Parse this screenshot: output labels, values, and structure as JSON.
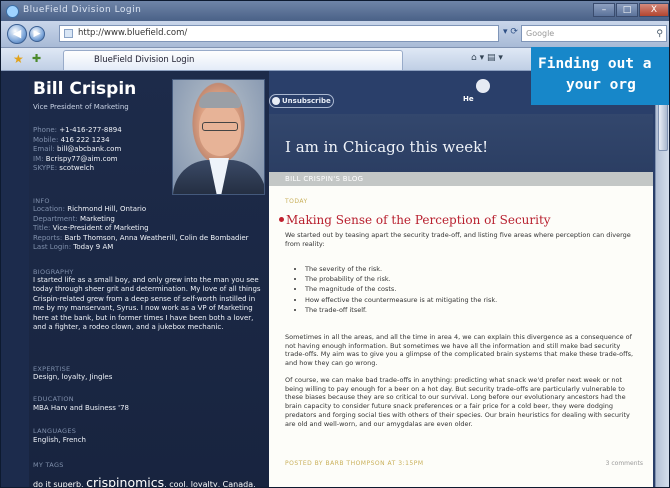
{
  "window": {
    "title": "BlueField Division Login",
    "controls": {
      "minimize": "–",
      "maximize": "□",
      "close": "X"
    }
  },
  "navbar": {
    "back": "◀",
    "forward": "▶",
    "url": "http://www.bluefield.com/",
    "search_placeholder": "Google"
  },
  "tabs": [
    {
      "label": "BlueField Division Login"
    }
  ],
  "profile": {
    "name": "Bill Crispin",
    "role": "Vice President of Marketing",
    "contact": [
      {
        "k": "Phone:",
        "v": "+1-416-277-8894"
      },
      {
        "k": "Mobile:",
        "v": "416 222 1234"
      },
      {
        "k": "Email:",
        "v": "bill@abcbank.com"
      },
      {
        "k": "IM:",
        "v": "Bcrispy77@aim.com"
      },
      {
        "k": "SKYPE:",
        "v": "scotwelch"
      }
    ],
    "info_heading": "INFO",
    "info": [
      {
        "k": "Location:",
        "v": "Richmond Hill, Ontario"
      },
      {
        "k": "Department:",
        "v": "Marketing"
      },
      {
        "k": "Title:",
        "v": "Vice-President of Marketing"
      },
      {
        "k": "Reports:",
        "v": "Barb Thomson, Anna Weatherill, Colin de Bombadier"
      },
      {
        "k": "Last Login:",
        "v": "Today 9 AM"
      }
    ],
    "biography_heading": "BIOGRAPHY",
    "biography": "I started life as a small boy, and only grew into the man you see today through sheer grit and determination. My love of all things Crispin-related grew from a deep sense of self-worth instilled in me by my manservant, Syrus. I now work as a VP of Marketing here at the bank, but in former times I have been both a lover, and a fighter, a rodeo clown, and a jukebox mechanic.",
    "expertise_heading": "EXPERTISE",
    "expertise": "Design, loyalty, Jingles",
    "education_heading": "EDUCATION",
    "education": "MBA Harv and Business '78",
    "languages_heading": "LANGUAGES",
    "languages": "English, French",
    "tags_heading": "MY TAGS",
    "tags": {
      "pre": "do it superb,",
      "big": "crispinomics",
      "post": ", cool, loyalty, Canada,"
    }
  },
  "blog_header": {
    "unsubscribe": "Unsubscribe",
    "he_label": "He",
    "location_status": "I am in Chicago this week!",
    "section_title": "BILL CRISPIN'S BLOG"
  },
  "post": {
    "date_label": "TODAY",
    "title": "Making Sense of the Perception of Security",
    "intro": "We started out by teasing apart the security trade-off, and listing five areas where perception can diverge from reality:",
    "bullets": [
      "The severity of the risk.",
      "The probability of the risk.",
      "The magnitude of the costs.",
      "How effective the countermeasure is at mitigating the risk.",
      "The trade-off itself."
    ],
    "para1": "Sometimes in all the areas, and all the time in area 4, we can explain this divergence as a consequence of not having enough information. But sometimes we have all the information and still make bad security trade-offs. My aim was to give you a glimpse of the complicated brain systems that make these trade-offs, and how they can go wrong.",
    "para2": "Of course, we can make bad trade-offs in anything: predicting what snack we'd prefer next week or not being willing to pay enough for a beer on a hot day. But security trade-offs are particularly vulnerable to these biases because they are so critical to our survival. Long before our evolutionary ancestors had the brain capacity to consider future snack preferences or a fair price for a cold beer, they were dodging predators and forging social ties with others of their species. Our brain heuristics for dealing with security are old and well-worn, and our amygdalas are even older.",
    "byline": "POSTED BY BARB THOMPSON AT 3:15PM",
    "comments": "3 comments"
  },
  "callout": {
    "line1": "Finding out a",
    "line2": "your org"
  },
  "colors": {
    "accent": "#1787c9",
    "profile_bg": "#1d2b4a",
    "post_title": "#b8202f",
    "meta_gold": "#c9b05a"
  }
}
